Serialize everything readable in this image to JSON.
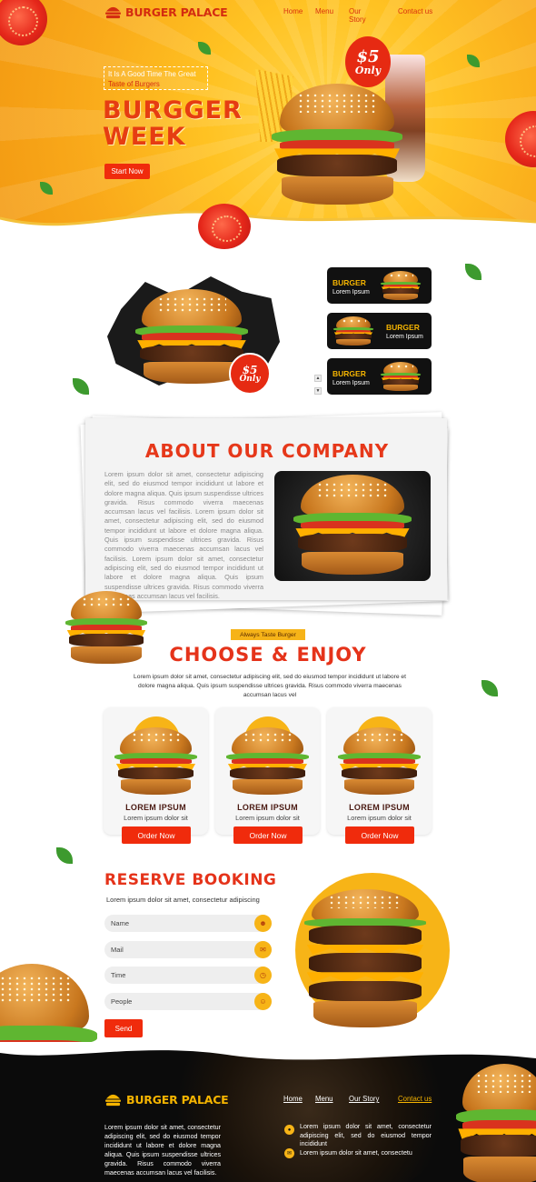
{
  "brand": {
    "name": "BURGER PALACE"
  },
  "nav": {
    "home": "Home",
    "menu": "Menu",
    "story": "Our Story",
    "contact": "Contact us"
  },
  "hero": {
    "tag_line1": "It Is A Good Time The Great",
    "tag_line2": "Taste of Burgers",
    "title_line1": "BURGGER",
    "title_line2": "WEEK",
    "cta": "Start Now",
    "price": "$5",
    "price_sub": "Only"
  },
  "slider": {
    "badge_price": "$5",
    "badge_sub": "Only",
    "cards": [
      {
        "title": "BURGER",
        "subtitle": "Lorem Ipsum"
      },
      {
        "title": "BURGER",
        "subtitle": "Lorem Ipsum"
      },
      {
        "title": "BURGER",
        "subtitle": "Lorem Ipsum"
      }
    ],
    "arrow_up": "▲",
    "arrow_down": "▼"
  },
  "about": {
    "title": "ABOUT OUR COMPANY",
    "paragraph": "Lorem ipsum dolor sit amet, consectetur adipiscing elit, sed do eiusmod tempor incididunt ut labore et dolore magna aliqua. Quis ipsum suspendisse ultrices gravida. Risus commodo viverra maecenas accumsan lacus vel facilisis. Lorem ipsum dolor sit amet, consectetur adipiscing elit, sed do eiusmod tempor incididunt ut labore et dolore magna aliqua. Quis ipsum suspendisse ultrices gravida. Risus commodo viverra maecenas accumsan lacus vel facilisis. Lorem ipsum dolor sit amet, consectetur adipiscing elit, sed do eiusmod tempor incididunt ut labore et dolore magna aliqua. Quis ipsum suspendisse ultrices gravida. Risus commodo viverra maecenas accumsan lacus vel facilisis."
  },
  "choose": {
    "pill": "Always Taste Burger",
    "title": "CHOOSE & ENJOY",
    "text": "Lorem ipsum dolor sit amet, consectetur adipiscing elit, sed do eiusmod tempor incididunt ut labore et dolore magna aliqua. Quis ipsum suspendisse ultrices gravida. Risus commodo viverra maecenas accumsan lacus vel",
    "products": [
      {
        "title": "LOREM IPSUM",
        "subtitle": "Lorem ipsum dolor sit",
        "button": "Order Now"
      },
      {
        "title": "LOREM IPSUM",
        "subtitle": "Lorem ipsum dolor sit",
        "button": "Order Now"
      },
      {
        "title": "LOREM IPSUM",
        "subtitle": "Lorem ipsum dolor sit",
        "button": "Order Now"
      }
    ]
  },
  "reserve": {
    "title": "RESERVE BOOKING",
    "subtitle": "Lorem ipsum dolor sit amet, consectetur adipiscing",
    "fields": [
      "Name",
      "Mail",
      "Time",
      "People"
    ],
    "send": "Send"
  },
  "footer": {
    "brand": "BURGER PALACE",
    "nav": {
      "home": "Home",
      "menu": "Menu",
      "story": "Our Story",
      "contact": "Contact us"
    },
    "text": "Lorem ipsum dolor sit amet, consectetur adipiscing elit, sed do eiusmod tempor incididunt ut labore et dolore magna aliqua. Quis ipsum suspendisse ultrices gravida. Risus commodo viverra maecenas accumsan lacus vel facilisis.",
    "address": "Lorem ipsum dolor sit amet, consectetur adipiscing elit, sed do eiusmod tempor incididunt",
    "mail": "Lorem ipsum dolor sit amet, consectetu"
  },
  "colors": {
    "accent_red": "#e5331a",
    "accent_yellow": "#f7b417",
    "dark": "#0b0b0b"
  }
}
